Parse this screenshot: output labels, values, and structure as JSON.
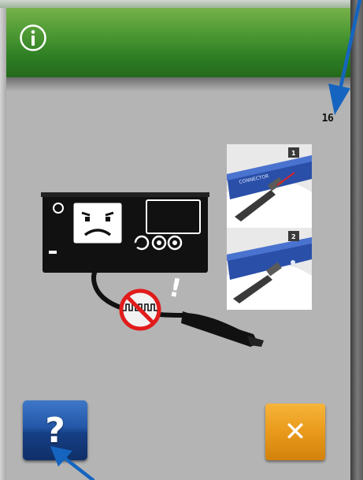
{
  "dialog": {
    "header_icon": "info-icon",
    "page_number": "16",
    "illustration": {
      "device_icon": "sad-face-console-icon",
      "no_sign_icon": "prohibited-cable-icon",
      "warning_mark": "!",
      "step_labels": [
        "1",
        "2"
      ]
    }
  },
  "buttons": {
    "help": {
      "icon": "question-mark-icon",
      "glyph": "?"
    },
    "close": {
      "icon": "close-icon",
      "glyph": "✕"
    }
  },
  "annotations": {
    "arrow_color": "#1565c0"
  },
  "colors": {
    "header_green": "#2e7f24",
    "panel_gray": "#b4b4b4",
    "help_blue": "#2356a6",
    "close_orange": "#e99a1b"
  }
}
